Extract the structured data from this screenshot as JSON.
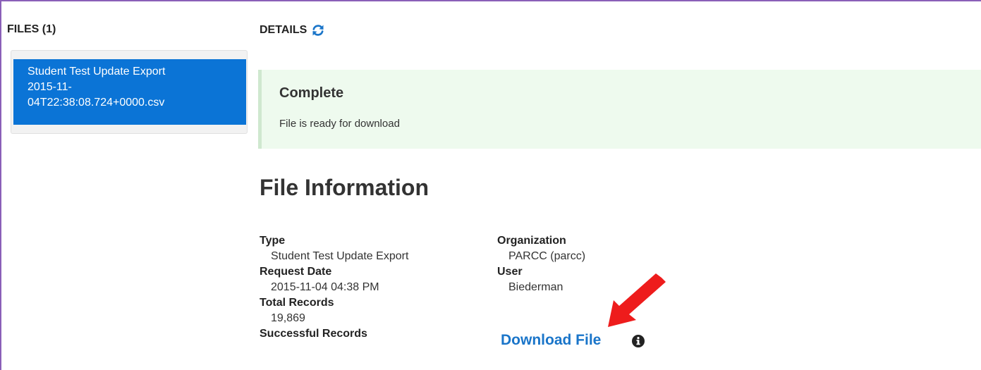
{
  "files": {
    "header": "FILES (1)",
    "items": [
      {
        "line1": "Student Test Update Export",
        "line2": "2015-11-",
        "line3": "04T22:38:08.724+0000.csv"
      }
    ]
  },
  "details": {
    "header": "DETAILS",
    "refresh_icon": "refresh-icon",
    "status_title": "Complete",
    "status_message": "File is ready for download"
  },
  "file_info": {
    "title": "File Information",
    "type_label": "Type",
    "type_value": "Student Test Update Export",
    "request_date_label": "Request Date",
    "request_date_value": "2015-11-04 04:38 PM",
    "total_records_label": "Total Records",
    "total_records_value": "19,869",
    "successful_records_label": "Successful Records",
    "organization_label": "Organization",
    "organization_value": "PARCC (parcc)",
    "user_label": "User",
    "user_value": "Biederman",
    "download_label": "Download File",
    "info_icon": "info-icon"
  },
  "colors": {
    "accent": "#0b74d6",
    "link": "#1a75c9",
    "success_bg": "#eefaee",
    "annotation_arrow": "#ee1c1c",
    "frame_border": "#8a5fb8"
  }
}
